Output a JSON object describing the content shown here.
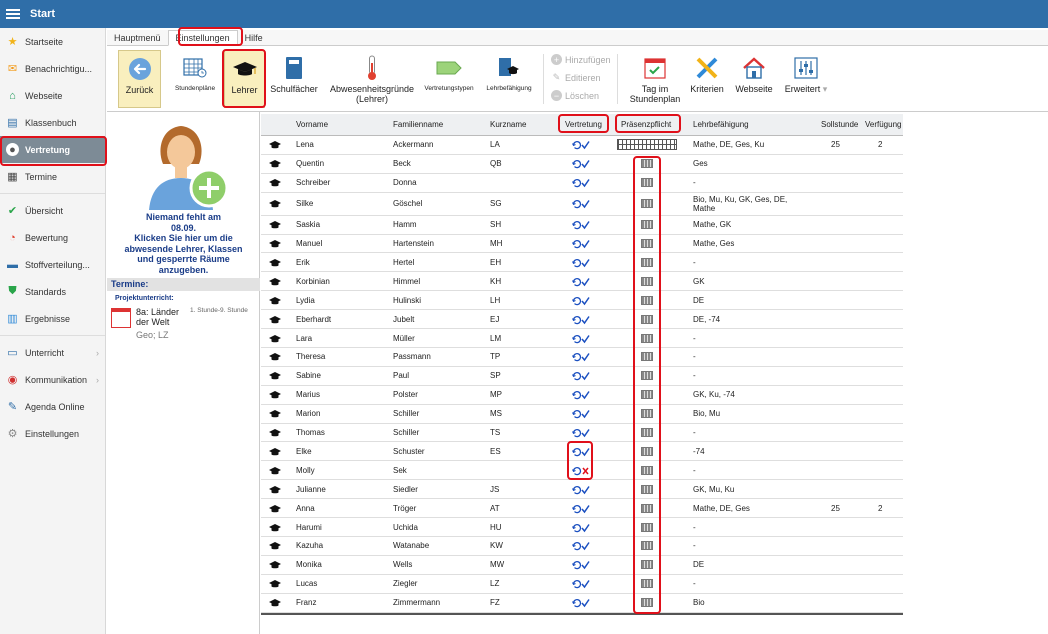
{
  "app": {
    "title": "Start"
  },
  "nav": {
    "items": [
      {
        "label": "Startseite",
        "icon": "star-icon",
        "color": "#f2b318"
      },
      {
        "label": "Benachrichtigu...",
        "icon": "envelope-icon",
        "color": "#f29a18"
      },
      {
        "label": "Webseite",
        "icon": "house-icon",
        "color": "#1e9a5a"
      },
      {
        "label": "Klassenbuch",
        "icon": "book-icon",
        "color": "#2f6ea8"
      },
      {
        "label": "Vertretung",
        "icon": "person-icon",
        "color": "#555555",
        "active": true
      },
      {
        "label": "Termine",
        "icon": "calendar-icon",
        "color": "#444444"
      },
      {
        "label": "Übersicht",
        "icon": "check-circle-icon",
        "color": "#2aa54a"
      },
      {
        "label": "Bewertung",
        "icon": "gauge-icon",
        "color": "#e04030"
      },
      {
        "label": "Stoffverteilung...",
        "icon": "briefcase-icon",
        "color": "#2f6ea8"
      },
      {
        "label": "Standards",
        "icon": "shield-icon",
        "color": "#2aa54a"
      },
      {
        "label": "Ergebnisse",
        "icon": "bar-chart-icon",
        "color": "#2f8ad8"
      },
      {
        "label": "Unterricht",
        "icon": "monitor-icon",
        "color": "#2f6ea8",
        "chevron": "›"
      },
      {
        "label": "Kommunikation",
        "icon": "chat-icon",
        "color": "#d03030",
        "chevron": "›"
      },
      {
        "label": "Agenda Online",
        "icon": "pen-icon",
        "color": "#2f6ea8"
      },
      {
        "label": "Einstellungen",
        "icon": "gear-icon",
        "color": "#888888"
      }
    ]
  },
  "menu": {
    "tabs": [
      "Hauptmenü",
      "Einstellungen",
      "Hilfe"
    ]
  },
  "ribbon": {
    "zurueck": "Zurück",
    "stundenplaene": "Stundenpläne",
    "lehrer": "Lehrer",
    "schulfaecher": "Schulfächer",
    "abwesenheit_1": "Abwesenheitsgründe",
    "abwesenheit_2": "(Lehrer)",
    "vertretungstypen": "Vertretungstypen",
    "lehrbefaehigung": "Lehrbefähigung",
    "hinzufuegen": "Hinzufügen",
    "editieren": "Editieren",
    "loeschen": "Löschen",
    "tag_1": "Tag im",
    "tag_2": "Stundenplan",
    "kriterien": "Kriterien",
    "webseite": "Webseite",
    "erweitert": "Erweitert"
  },
  "info": {
    "absent_lines": [
      "Niemand fehlt am",
      "08.09.",
      "Klicken Sie hier um die",
      "abwesende Lehrer, Klassen",
      "und gesperrte Räume",
      "anzugeben."
    ],
    "termine": "Termine:",
    "projekt": "Projektunterricht:",
    "term_title_1": "8a: Länder",
    "term_title_2": "der Welt",
    "term_time": "1. Stunde-9. Stunde",
    "term_sub": "Geo; LZ"
  },
  "table": {
    "headers": {
      "vorname": "Vorname",
      "familienname": "Familienname",
      "kurzname": "Kurzname",
      "vertretung": "Vertretung",
      "praesenz": "Präsenzpflicht",
      "lehrbef": "Lehrbefähigung",
      "soll": "Sollstunde",
      "verf": "Verfügung"
    },
    "rows": [
      {
        "vorname": "Lena",
        "familienname": "Ackermann",
        "kurz": "LA",
        "lehrbef": "Mathe, DE, Ges, Ku",
        "soll": "25",
        "verf": "2",
        "vertretung": "ok"
      },
      {
        "vorname": "Quentin",
        "familienname": "Beck",
        "kurz": "QB",
        "lehrbef": "Ges",
        "soll": "",
        "verf": "",
        "vertretung": "ok"
      },
      {
        "vorname": "Schreiber",
        "familienname": "Donna",
        "kurz": "",
        "lehrbef": "-",
        "soll": "",
        "verf": "",
        "vertretung": "ok"
      },
      {
        "vorname": "Silke",
        "familienname": "Göschel",
        "kurz": "SG",
        "lehrbef": "Bio, Mu, Ku, GK, Ges, DE, Mathe",
        "soll": "",
        "verf": "",
        "vertretung": "ok"
      },
      {
        "vorname": "Saskia",
        "familienname": "Hamm",
        "kurz": "SH",
        "lehrbef": "Mathe, GK",
        "soll": "",
        "verf": "",
        "vertretung": "ok"
      },
      {
        "vorname": "Manuel",
        "familienname": "Hartenstein",
        "kurz": "MH",
        "lehrbef": "Mathe, Ges",
        "soll": "",
        "verf": "",
        "vertretung": "ok"
      },
      {
        "vorname": "Erik",
        "familienname": "Hertel",
        "kurz": "EH",
        "lehrbef": "-",
        "soll": "",
        "verf": "",
        "vertretung": "ok"
      },
      {
        "vorname": "Korbinian",
        "familienname": "Himmel",
        "kurz": "KH",
        "lehrbef": "GK",
        "soll": "",
        "verf": "",
        "vertretung": "ok"
      },
      {
        "vorname": "Lydia",
        "familienname": "Hulinski",
        "kurz": "LH",
        "lehrbef": "DE",
        "soll": "",
        "verf": "",
        "vertretung": "ok"
      },
      {
        "vorname": "Eberhardt",
        "familienname": "Jubelt",
        "kurz": "EJ",
        "lehrbef": "DE, -74",
        "soll": "",
        "verf": "",
        "vertretung": "ok"
      },
      {
        "vorname": "Lara",
        "familienname": "Müller",
        "kurz": "LM",
        "lehrbef": "-",
        "soll": "",
        "verf": "",
        "vertretung": "ok"
      },
      {
        "vorname": "Theresa",
        "familienname": "Passmann",
        "kurz": "TP",
        "lehrbef": "-",
        "soll": "",
        "verf": "",
        "vertretung": "ok"
      },
      {
        "vorname": "Sabine",
        "familienname": "Paul",
        "kurz": "SP",
        "lehrbef": "-",
        "soll": "",
        "verf": "",
        "vertretung": "ok"
      },
      {
        "vorname": "Marius",
        "familienname": "Polster",
        "kurz": "MP",
        "lehrbef": "GK, Ku, -74",
        "soll": "",
        "verf": "",
        "vertretung": "ok"
      },
      {
        "vorname": "Marion",
        "familienname": "Schiller",
        "kurz": "MS",
        "lehrbef": "Bio, Mu",
        "soll": "",
        "verf": "",
        "vertretung": "ok"
      },
      {
        "vorname": "Thomas",
        "familienname": "Schiller",
        "kurz": "TS",
        "lehrbef": "-",
        "soll": "",
        "verf": "",
        "vertretung": "ok"
      },
      {
        "vorname": "Elke",
        "familienname": "Schuster",
        "kurz": "ES",
        "lehrbef": "-74",
        "soll": "",
        "verf": "",
        "vertretung": "ok"
      },
      {
        "vorname": "Molly",
        "familienname": "Sek",
        "kurz": "",
        "lehrbef": "-",
        "soll": "",
        "verf": "",
        "vertretung": "no"
      },
      {
        "vorname": "Julianne",
        "familienname": "Siedler",
        "kurz": "JS",
        "lehrbef": "GK, Mu, Ku",
        "soll": "",
        "verf": "",
        "vertretung": "ok"
      },
      {
        "vorname": "Anna",
        "familienname": "Tröger",
        "kurz": "AT",
        "lehrbef": "Mathe, DE, Ges",
        "soll": "25",
        "verf": "2",
        "vertretung": "ok"
      },
      {
        "vorname": "Harumi",
        "familienname": "Uchida",
        "kurz": "HU",
        "lehrbef": "-",
        "soll": "",
        "verf": "",
        "vertretung": "ok"
      },
      {
        "vorname": "Kazuha",
        "familienname": "Watanabe",
        "kurz": "KW",
        "lehrbef": "-",
        "soll": "",
        "verf": "",
        "vertretung": "ok"
      },
      {
        "vorname": "Monika",
        "familienname": "Wells",
        "kurz": "MW",
        "lehrbef": "DE",
        "soll": "",
        "verf": "",
        "vertretung": "ok"
      },
      {
        "vorname": "Lucas",
        "familienname": "Ziegler",
        "kurz": "LZ",
        "lehrbef": "-",
        "soll": "",
        "verf": "",
        "vertretung": "ok"
      },
      {
        "vorname": "Franz",
        "familienname": "Zimmermann",
        "kurz": "FZ",
        "lehrbef": "Bio",
        "soll": "",
        "verf": "",
        "vertretung": "ok"
      }
    ]
  },
  "colors": {
    "topbar": "#2f6ea8",
    "highlight": "#e0101a",
    "vertretung_ok": "#1a4fc0",
    "vertretung_no": "#e0101a"
  }
}
